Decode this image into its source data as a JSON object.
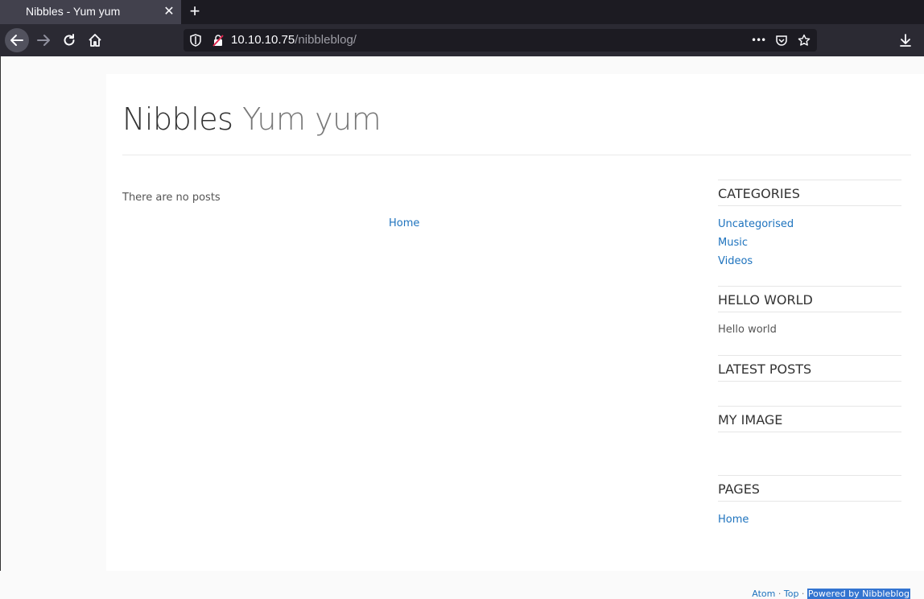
{
  "browser": {
    "tab_title": "Nibbles - Yum yum",
    "tab_close": "✕",
    "new_tab": "+",
    "url_host": "10.10.10.75",
    "url_path": "/nibbleblog/",
    "url_more": "•••"
  },
  "site": {
    "name": "Nibbles",
    "slogan": "Yum yum"
  },
  "main": {
    "no_posts": "There are no posts",
    "home_link": "Home"
  },
  "sidebar": {
    "categories": {
      "title": "CATEGORIES",
      "items": [
        "Uncategorised",
        "Music",
        "Videos"
      ]
    },
    "hello_world": {
      "title": "HELLO WORLD",
      "text": "Hello world"
    },
    "latest_posts": {
      "title": "LATEST POSTS"
    },
    "my_image": {
      "title": "MY IMAGE"
    },
    "pages": {
      "title": "PAGES",
      "items": [
        "Home"
      ]
    }
  },
  "footer": {
    "atom": "Atom",
    "sep1": " · ",
    "top": "Top",
    "sep2": " · ",
    "powered": "Powered by Nibbleblog"
  }
}
